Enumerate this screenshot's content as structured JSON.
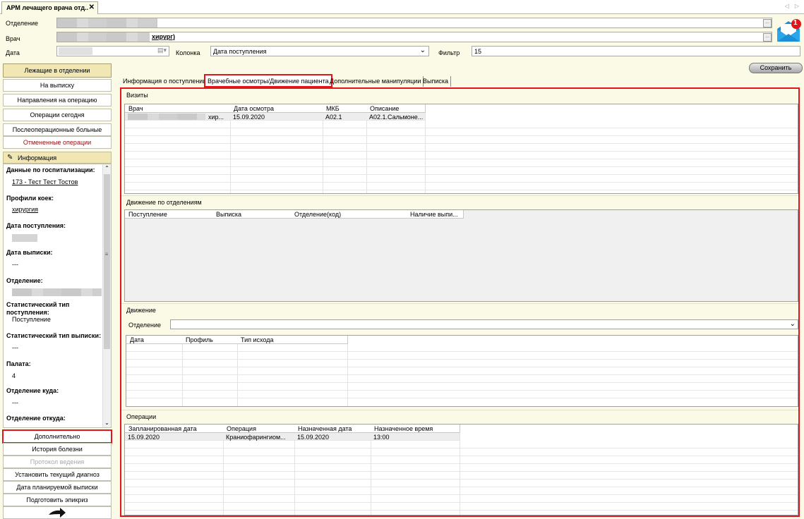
{
  "window": {
    "tab_title": "АРМ лечащего врача отд..",
    "close_glyph": "✕",
    "nav_arrows": "◁ ▷"
  },
  "header": {
    "department_label": "Отделение",
    "doctor_label": "Врач",
    "doctor_value": "хирург)",
    "date_label": "Дата",
    "column_label": "Колонка",
    "column_value": "Дата поступления",
    "filter_label": "Фильтр",
    "filter_value": "15",
    "ellipsis": "...",
    "notification_count": "1"
  },
  "save_label": "Сохранить",
  "nav": {
    "items": [
      "Лежащие в отделении",
      "На выписку",
      "Направления на операцию",
      "Операции сегодня",
      "Послеоперационные больные",
      "Отмененные операции"
    ],
    "info_label": "Информация",
    "bottom_items": [
      "Дополнительно",
      "История болезни",
      "Протокол ведения",
      "Установить текущий диагноз",
      "Дата планируемой выписки",
      "Подготовить эпикриз"
    ]
  },
  "info": {
    "hosp_label": "Данные по госпитализации:",
    "hosp_value": "173 - Тест Тест Тостов",
    "bed_profile_label": "Профили коек:",
    "bed_profile_value": "хирургия",
    "admit_date_label": "Дата поступления:",
    "discharge_date_label": "Дата выписки:",
    "discharge_date_value": "---",
    "dept_label": "Отделение:",
    "stat_admit_label_1": "Статистический тип",
    "stat_admit_label_2": "поступления:",
    "stat_admit_value": "Поступление",
    "stat_discharge_label": "Статистический тип выписки:",
    "stat_discharge_value": "---",
    "ward_label": "Палата:",
    "ward_value": "4",
    "dept_to_label": "Отделение куда:",
    "dept_to_value": "---",
    "dept_from_label": "Отделение откуда:"
  },
  "tabs": [
    "Информация о поступлении",
    "Врачебные осмотры/Движение пациента",
    "Дополнительные манипуляции",
    "Выписка"
  ],
  "visits": {
    "title": "Визиты",
    "columns": [
      "Врач",
      "Дата осмотра",
      "МКБ",
      "Описание"
    ],
    "row": {
      "doctor": "хир...",
      "date": "15.09.2020",
      "mkb": "A02.1",
      "description": "A02.1.Сальмоне..."
    }
  },
  "dept_movement": {
    "title": "Движение по отделениям",
    "columns": [
      "Поступление",
      "Выписка",
      "Отделение(код)",
      "Наличие выпи..."
    ]
  },
  "movement": {
    "title": "Движение",
    "dept_label": "Отделение",
    "columns": [
      "Дата",
      "Профиль",
      "Тип исхода"
    ]
  },
  "operations": {
    "title": "Операции",
    "columns": [
      "Запланированная дата",
      "Операция",
      "Назначенная дата",
      "Назначенное время"
    ],
    "row": {
      "planned": "15.09.2020",
      "operation": "Краниофарингиом...",
      "assigned_date": "15.09.2020",
      "assigned_time": "13:00"
    }
  }
}
